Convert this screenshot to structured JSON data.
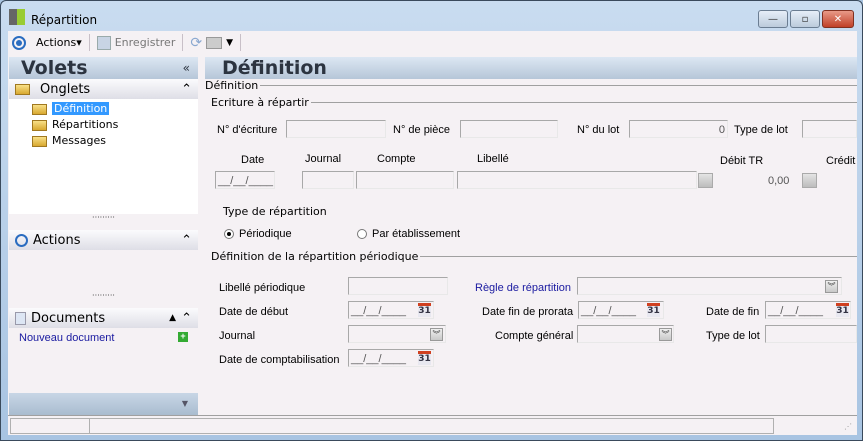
{
  "window": {
    "title": "Répartition",
    "controls": {
      "minimize": "—",
      "maximize": "▫",
      "close": "✕"
    }
  },
  "toolbar": {
    "actions": "Actions",
    "save": "Enregistrer"
  },
  "sidebar": {
    "title": "Volets",
    "collapse": "«",
    "onglets": {
      "label": "Onglets",
      "items": [
        "Définition",
        "Répartitions",
        "Messages"
      ],
      "selected": 0
    },
    "actions": {
      "label": "Actions"
    },
    "documents": {
      "label": "Documents",
      "new_doc": "Nouveau document"
    }
  },
  "main": {
    "title": "Définition",
    "section_definition": "Définition",
    "section_ecriture": "Ecriture à répartir",
    "ecriture": {
      "num_ecriture_label": "N° d'écriture",
      "num_piece_label": "N° de pièce",
      "num_lot_label": "N° du lot",
      "num_lot_value": "0",
      "type_lot_label": "Type de lot"
    },
    "grid": {
      "headers": [
        "Date",
        "Journal",
        "Compte",
        "Libellé",
        "Débit TR",
        "Crédit"
      ],
      "date_value": "__/__/____",
      "debit_value": "0,00"
    },
    "type_repartition": {
      "label": "Type de répartition",
      "options": [
        "Périodique",
        "Par établissement"
      ],
      "selected": 0
    },
    "section_periodique": "Définition de la répartition périodique",
    "periodique": {
      "libelle_label": "Libellé périodique",
      "regle_label": "Règle de répartition",
      "date_debut_label": "Date de début",
      "date_debut_value": "__/__/____",
      "date_fin_prorata_label": "Date fin de prorata",
      "date_fin_prorata_value": "__/__/____",
      "date_fin_label": "Date de fin",
      "date_fin_value": "__/__/____",
      "journal_label": "Journal",
      "compte_general_label": "Compte général",
      "type_lot_label": "Type de lot",
      "date_compta_label": "Date de comptabilisation",
      "date_compta_value": "__/__/____",
      "calendar_glyph": "31"
    }
  },
  "colors": {
    "link": "#1a1aa0",
    "selection": "#3399ff"
  }
}
